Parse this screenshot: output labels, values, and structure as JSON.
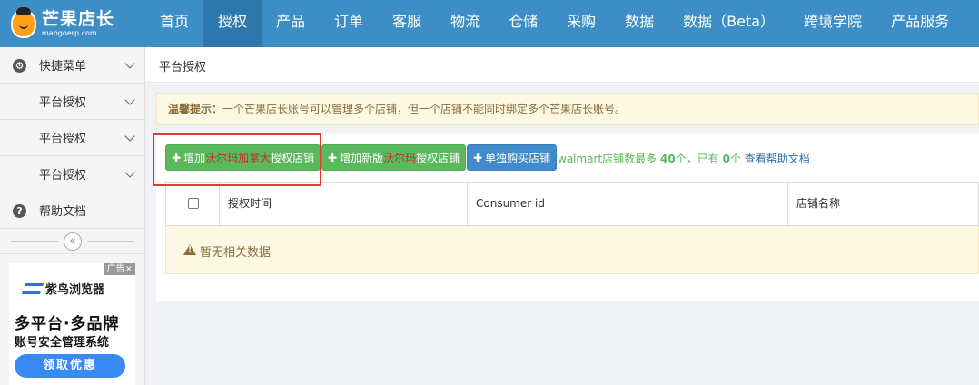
{
  "brand": {
    "title": "芒果店长",
    "subtitle": "mangoerp.com"
  },
  "nav": [
    {
      "label": "首页"
    },
    {
      "label": "授权",
      "active": true
    },
    {
      "label": "产品"
    },
    {
      "label": "订单"
    },
    {
      "label": "客服"
    },
    {
      "label": "物流"
    },
    {
      "label": "仓储"
    },
    {
      "label": "采购"
    },
    {
      "label": "数据"
    },
    {
      "label": "数据（Beta）"
    },
    {
      "label": "跨境学院"
    },
    {
      "label": "产品服务"
    }
  ],
  "sidebar": {
    "items": [
      {
        "label": "快捷菜单",
        "icon": "gear-icon"
      },
      {
        "label": "平台授权"
      },
      {
        "label": "平台授权"
      },
      {
        "label": "平台授权"
      },
      {
        "label": "帮助文档",
        "icon": "help-icon"
      }
    ],
    "collapse_glyph": "«"
  },
  "ad": {
    "tag": "广告",
    "close": "×",
    "brand": "紫鸟浏览器",
    "headline": "多平台·多品牌",
    "subline": "账号安全管理系统",
    "cta": "领取优惠"
  },
  "breadcrumb": "平台授权",
  "notice": {
    "label": "温馨提示：",
    "text": "一个芒果店长账号可以管理多个店铺，但一个店铺不能同时绑定多个芒果店长账号。"
  },
  "buttons": {
    "add_canada": {
      "prefix": "增加",
      "highlight": "沃尔玛加拿大",
      "suffix": "授权店铺"
    },
    "add_new": {
      "prefix": "增加新版",
      "highlight": "沃尔玛",
      "suffix": "授权店铺"
    },
    "buy": {
      "label": "单独购买店铺"
    }
  },
  "store_info": {
    "prefix": "walmart店铺数最多",
    "max": "40",
    "mid": "个，已有",
    "current": "0",
    "suffix": "个",
    "link": "查看帮助文档"
  },
  "table": {
    "columns": [
      "授权时间",
      "Consumer id",
      "店铺名称"
    ],
    "empty_text": "暂无相关数据"
  },
  "colors": {
    "nav_bg": "#3d8ec6",
    "nav_active": "#2e77ad",
    "green": "#5cb85c",
    "blue": "#428bca",
    "highlight_border": "#e53935"
  }
}
